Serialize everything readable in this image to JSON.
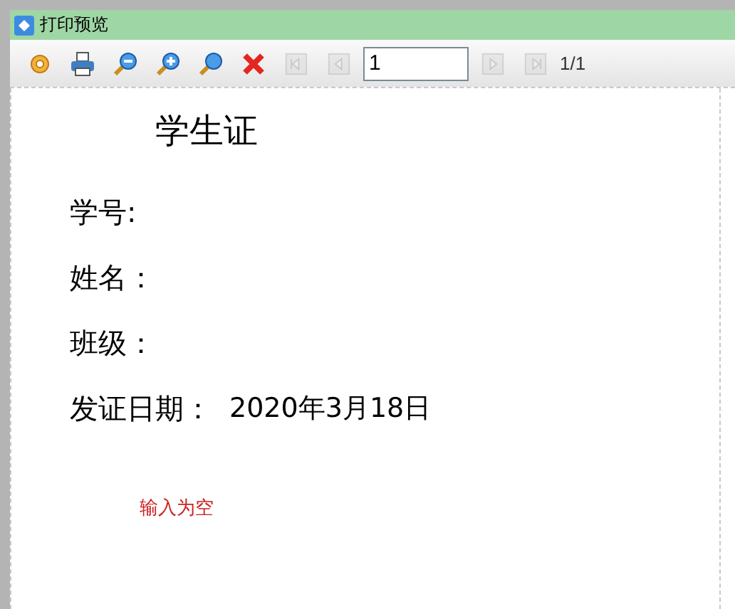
{
  "window": {
    "title": "打印预览"
  },
  "toolbar": {
    "buttons": [
      {
        "kind": "settings",
        "disabled": false
      },
      {
        "kind": "print",
        "disabled": false
      },
      {
        "kind": "zoom-out",
        "disabled": false
      },
      {
        "kind": "zoom-in",
        "disabled": false
      },
      {
        "kind": "zoom",
        "disabled": false
      },
      {
        "kind": "close",
        "disabled": false
      },
      {
        "kind": "first",
        "disabled": true
      },
      {
        "kind": "prev",
        "disabled": true
      }
    ],
    "page_input": {
      "value": "1"
    },
    "nav_buttons": [
      {
        "kind": "next",
        "disabled": true
      },
      {
        "kind": "last",
        "disabled": true
      }
    ],
    "page_count": "1/1"
  },
  "document": {
    "title": "学生证",
    "fields": [
      {
        "label": "学号:"
      },
      {
        "label": "姓名："
      },
      {
        "label": "班级："
      },
      {
        "label": "发证日期：",
        "value": "2020年3月18日"
      }
    ],
    "message": "输入为空"
  }
}
